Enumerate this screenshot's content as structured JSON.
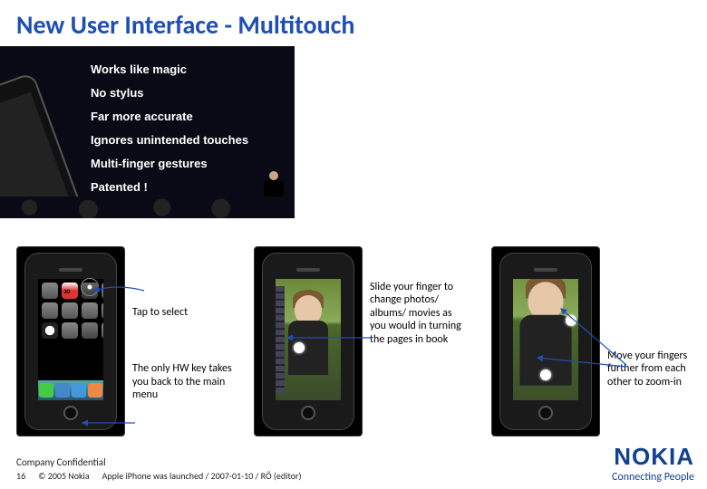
{
  "title": "New User Interface - Multitouch",
  "keynote_bullets": [
    "Works like magic",
    "No stylus",
    "Far more accurate",
    "Ignores unintended touches",
    "Multi-finger gestures",
    "Patented !"
  ],
  "phone1": {
    "calendar_day": "30",
    "ann_tap": "Tap to select",
    "ann_home": "The only HW key takes you back to the main menu"
  },
  "phone2": {
    "ann_slide": "Slide your finger to change photos/ albums/ movies as you would in turning the pages in book"
  },
  "phone3": {
    "ann_zoom": "Move your fingers further from each other to zoom-in"
  },
  "footer": {
    "confidential": "Company Confidential",
    "page_number": "16",
    "copyright": "© 2005  Nokia",
    "note": "Apple iPhone was launched / 2007-01-10 / RÖ (editor)"
  },
  "brand": {
    "logo": "NOKIA",
    "tagline": "Connecting People"
  }
}
